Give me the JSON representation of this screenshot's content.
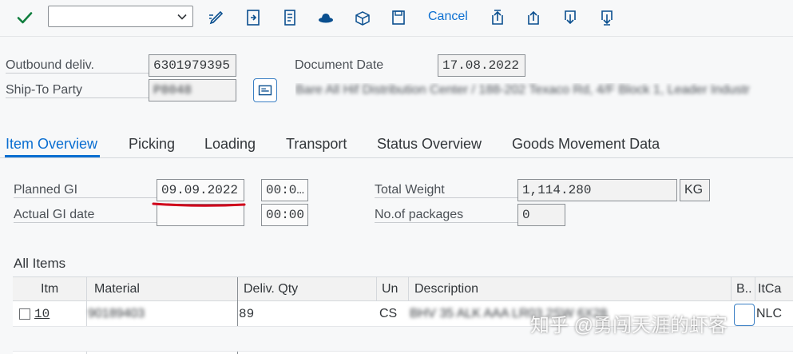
{
  "toolbar": {
    "command_field": {
      "value": "",
      "placeholder": ""
    },
    "cancel_label": "Cancel"
  },
  "header": {
    "outbound_delivery": {
      "label": "Outbound deliv.",
      "value": "6301979395"
    },
    "ship_to_party": {
      "label": "Ship-To Party",
      "value": "P8048"
    },
    "document_date": {
      "label": "Document Date",
      "value": "17.08.2022"
    },
    "ship_to_address": "Bare All Hif Distribution Center / 188-202 Texaco Rd, 4/F Block 1, Leader Industr"
  },
  "tabs": [
    {
      "label": "Item Overview",
      "active": true
    },
    {
      "label": "Picking"
    },
    {
      "label": "Loading"
    },
    {
      "label": "Transport"
    },
    {
      "label": "Status Overview"
    },
    {
      "label": "Goods Movement Data"
    }
  ],
  "item_overview": {
    "planned_gi": {
      "label": "Planned GI",
      "date": "09.09.2022",
      "time": "00:0…"
    },
    "actual_gi_date": {
      "label": "Actual GI date",
      "date": "",
      "time": "00:00"
    },
    "total_weight": {
      "label": "Total Weight",
      "value": "1,114.280",
      "unit": "KG"
    },
    "packages": {
      "label": "No.of packages",
      "value": "0"
    }
  },
  "all_items": {
    "title": "All Items",
    "columns": [
      "Itm",
      "Material",
      "Deliv. Qty",
      "Un",
      "Description",
      "B..",
      "ItCa"
    ],
    "rows": [
      {
        "itm": "10",
        "material": "90189403",
        "qty": "89",
        "un": "CS",
        "description": "BHV 35 ALK AAA LR03 2SW 6X28",
        "itca": "NLC"
      }
    ]
  },
  "watermark": "知乎 @勇闯天涯的虾客",
  "colors": {
    "accent": "#0a6ed1",
    "confirm_green": "#107e3e",
    "annotation_red": "#d0021b"
  }
}
